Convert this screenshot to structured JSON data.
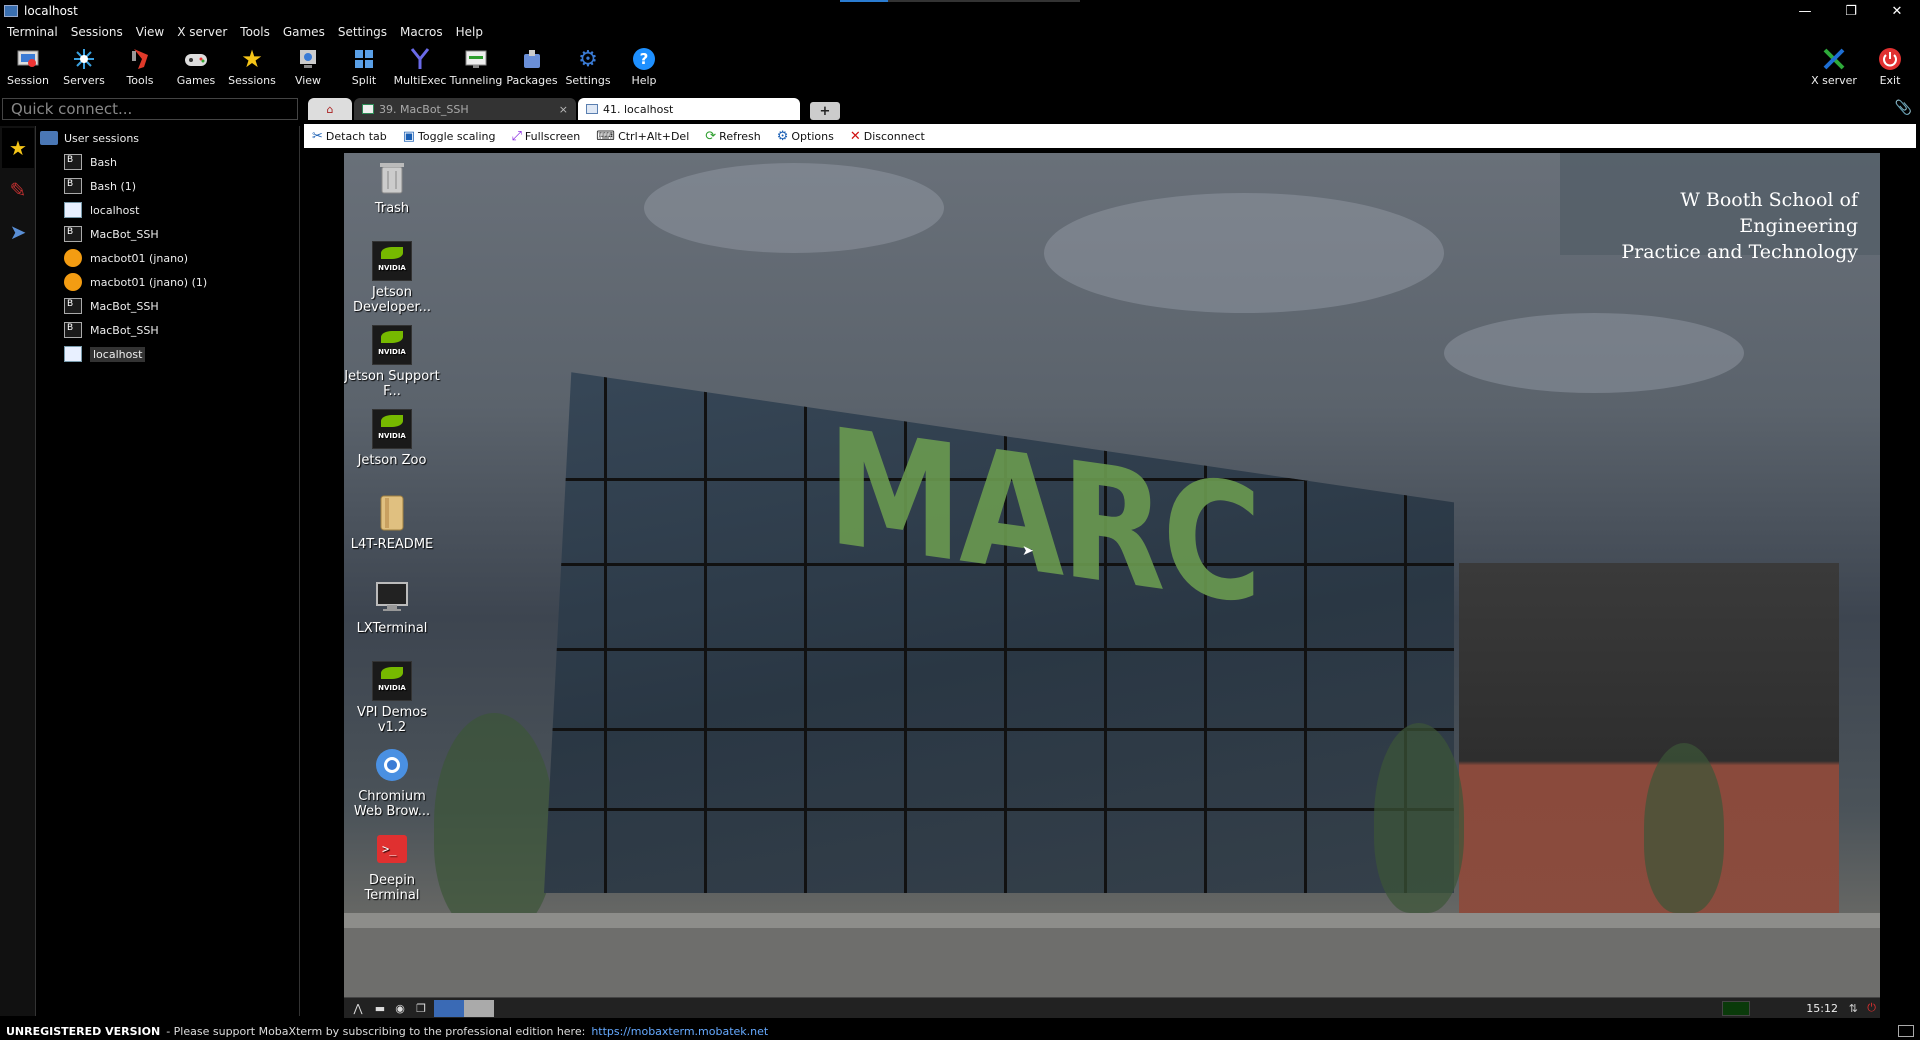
{
  "window": {
    "title": "localhost",
    "download_progress": 0.2,
    "min": "—",
    "restore": "❐",
    "close": "✕"
  },
  "menu": [
    "Terminal",
    "Sessions",
    "View",
    "X server",
    "Tools",
    "Games",
    "Settings",
    "Macros",
    "Help"
  ],
  "toolbar": {
    "left": [
      {
        "label": "Session",
        "icon": "session-icon"
      },
      {
        "label": "Servers",
        "icon": "servers-icon"
      },
      {
        "label": "Tools",
        "icon": "tools-icon"
      },
      {
        "label": "Games",
        "icon": "gamepad-icon"
      },
      {
        "label": "Sessions",
        "icon": "star-icon"
      },
      {
        "label": "View",
        "icon": "view-icon"
      },
      {
        "label": "Split",
        "icon": "split-icon"
      },
      {
        "label": "MultiExec",
        "icon": "multiexec-icon"
      },
      {
        "label": "Tunneling",
        "icon": "tunneling-icon"
      },
      {
        "label": "Packages",
        "icon": "packages-icon"
      },
      {
        "label": "Settings",
        "icon": "gear-icon"
      },
      {
        "label": "Help",
        "icon": "help-icon"
      }
    ],
    "xserver_label": "X server",
    "exit_label": "Exit"
  },
  "quick_connect": {
    "placeholder": "Quick connect..."
  },
  "tabs": [
    {
      "label": "39. MacBot_SSH",
      "active": false
    },
    {
      "label": "41. localhost",
      "active": true
    }
  ],
  "tab_new_label": "+",
  "tab_close_glyph": "×",
  "sessions": {
    "root_label": "User sessions",
    "items": [
      {
        "label": "Bash",
        "type": "terminal"
      },
      {
        "label": "Bash (1)",
        "type": "terminal"
      },
      {
        "label": "localhost",
        "type": "vnc"
      },
      {
        "label": "MacBot_SSH",
        "type": "terminal"
      },
      {
        "label": "macbot01 (jnano)",
        "type": "ssh"
      },
      {
        "label": "macbot01 (jnano) (1)",
        "type": "ssh"
      },
      {
        "label": "MacBot_SSH",
        "type": "terminal"
      },
      {
        "label": "MacBot_SSH",
        "type": "terminal"
      },
      {
        "label": "localhost",
        "type": "vnc",
        "selected": true
      }
    ]
  },
  "session_toolbar": [
    {
      "label": "Detach tab",
      "icon": "detach-icon",
      "glyph": "✂",
      "color": "#1a5fb4"
    },
    {
      "label": "Toggle scaling",
      "icon": "scaling-icon",
      "glyph": "▣",
      "color": "#1a5fb4"
    },
    {
      "label": "Fullscreen",
      "icon": "fullscreen-icon",
      "glyph": "⤢",
      "color": "#8a2be2"
    },
    {
      "label": "Ctrl+Alt+Del",
      "icon": "keyboard-icon",
      "glyph": "⌨",
      "color": "#333"
    },
    {
      "label": "Refresh",
      "icon": "refresh-icon",
      "glyph": "⟳",
      "color": "#2e9e2e"
    },
    {
      "label": "Options",
      "icon": "options-icon",
      "glyph": "⚙",
      "color": "#1a5fb4"
    },
    {
      "label": "Disconnect",
      "icon": "disconnect-icon",
      "glyph": "✕",
      "color": "#d01010"
    }
  ],
  "desktop": {
    "banner_line1": "W Booth School of Engineering",
    "banner_line2": "Practice and Technology",
    "building_sign": "MARC",
    "icons": [
      {
        "label": "Trash",
        "icon": "trash-icon"
      },
      {
        "label": "Jetson Developer...",
        "icon": "nvidia-icon"
      },
      {
        "label": "Jetson Support F...",
        "icon": "nvidia-icon"
      },
      {
        "label": "Jetson Zoo",
        "icon": "nvidia-icon"
      },
      {
        "label": "L4T-README",
        "icon": "folder-icon"
      },
      {
        "label": "LXTerminal",
        "icon": "monitor-icon"
      },
      {
        "label": "VPI Demos v1.2",
        "icon": "nvidia-icon"
      },
      {
        "label": "Chromium Web Brow...",
        "icon": "chromium-icon"
      },
      {
        "label": "Deepin Terminal",
        "icon": "deepin-terminal-icon"
      }
    ],
    "nvidia_word": "NVIDIA",
    "clock": "15:12"
  },
  "statusbar": {
    "unregistered": "UNREGISTERED VERSION",
    "message": "-  Please support MobaXterm by subscribing to the professional edition here:",
    "link": "https://mobaxterm.mobatek.net"
  }
}
